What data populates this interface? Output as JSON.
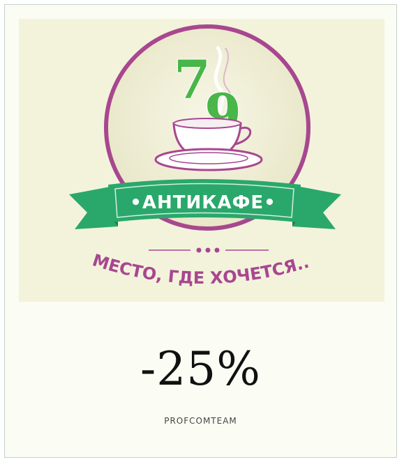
{
  "logo": {
    "number_left": "7",
    "number_right": "9",
    "ribbon_text": "•АНТИКАФЕ•",
    "slogan": "МЕСТО, ГДЕ ХОЧЕТСЯ...",
    "colors": {
      "background": "#f3f3dc",
      "circle_fill": "#eeedd2",
      "circle_stroke": "#a8478f",
      "ribbon": "#2aa86b",
      "ribbon_dark": "#1c7c4f",
      "number_green": "#48b649",
      "slogan": "#a8478f"
    }
  },
  "offer": {
    "discount": "-25%",
    "author": "PROFCOMTEAM"
  }
}
